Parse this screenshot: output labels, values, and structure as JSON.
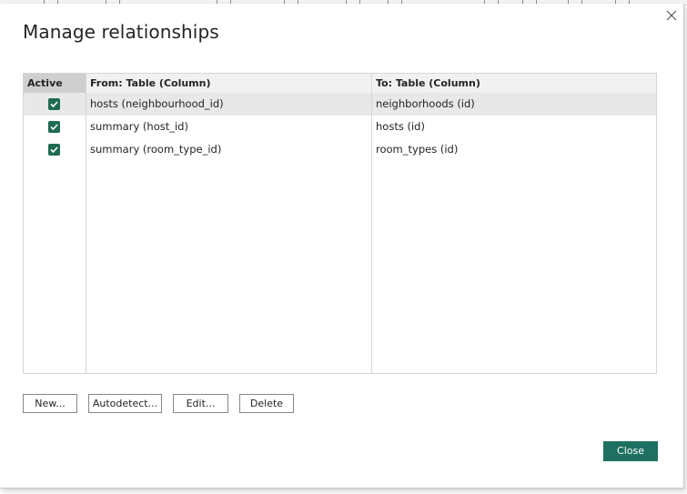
{
  "dialog": {
    "title": "Manage relationships"
  },
  "table": {
    "headers": {
      "active": "Active",
      "from": "From: Table (Column)",
      "to": "To: Table (Column)"
    },
    "rows": [
      {
        "active": true,
        "from": "hosts (neighbourhood_id)",
        "to": "neighborhoods (id)",
        "selected": true
      },
      {
        "active": true,
        "from": "summary (host_id)",
        "to": "hosts (id)",
        "selected": false
      },
      {
        "active": true,
        "from": "summary (room_type_id)",
        "to": "room_types (id)",
        "selected": false
      }
    ]
  },
  "buttons": {
    "new": "New...",
    "autodetect": "Autodetect...",
    "edit": "Edit...",
    "delete": "Delete",
    "close": "Close"
  },
  "icons": {
    "close": "close-icon",
    "check": "checkmark-icon"
  },
  "colors": {
    "accent": "#1e7160",
    "checkbox": "#1e6b52",
    "selected_row": "#e8e8e8"
  }
}
